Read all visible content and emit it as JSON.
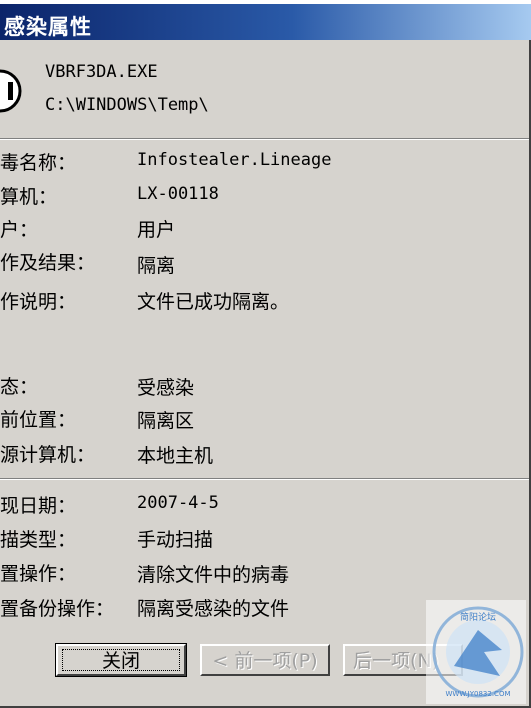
{
  "window": {
    "title": "感染属性"
  },
  "file": {
    "name": "VBRF3DA.EXE",
    "path": "C:\\WINDOWS\\Temp\\"
  },
  "details": {
    "virus_name_label": "毒名称：",
    "virus_name_value": "Infostealer.Lineage",
    "computer_label": "算机：",
    "computer_value": "LX-00118",
    "user_label": "户：",
    "user_value": "用户",
    "action_result_label": "作及结果：",
    "action_result_value": "隔离",
    "action_desc_label": "作说明：",
    "action_desc_value": "文件已成功隔离。"
  },
  "status": {
    "state_label": "态：",
    "state_value": "受感染",
    "location_label": "前位置：",
    "location_value": "隔离区",
    "origin_label": "源计算机：",
    "origin_value": "本地主机"
  },
  "scan": {
    "date_label": "现日期：",
    "date_value": "2007-4-5",
    "type_label": "描类型：",
    "type_value": "手动扫描",
    "op_label": "置操作：",
    "op_value": "清除文件中的病毒",
    "backup_label": "置备份操作：",
    "backup_value": "隔离受感染的文件"
  },
  "buttons": {
    "close": "关闭",
    "prev": "< 前一项(P)",
    "next": "后一项(N)"
  },
  "watermark": {
    "text_top": "简阳论坛",
    "text_url": "WWW.JY0832.COM"
  },
  "colors": {
    "title_bar_start": "#0b246a",
    "title_bar_end": "#a6caf0",
    "dialog_bg": "#d6d3ce"
  }
}
